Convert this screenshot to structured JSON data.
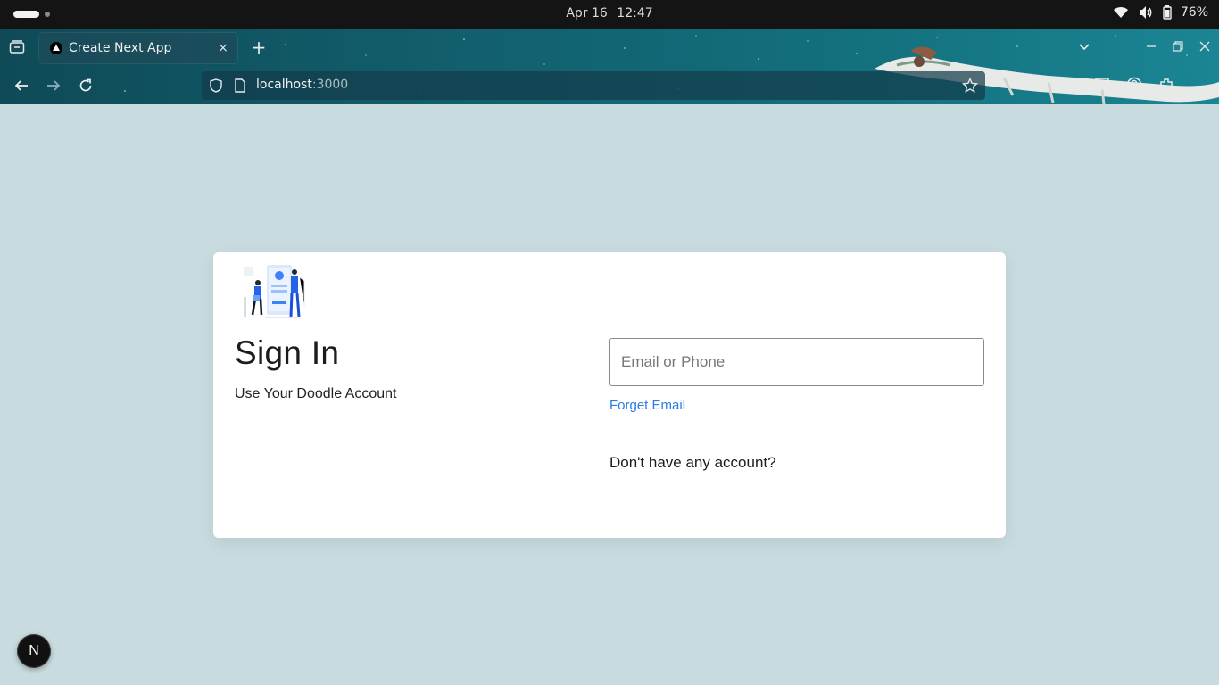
{
  "os": {
    "date": "Apr 16",
    "time": "12:47",
    "battery": "76%"
  },
  "browser": {
    "tab_title": "Create Next App",
    "tab_close": "×",
    "new_tab": "+",
    "url_host": "localhost",
    "url_port": ":3000"
  },
  "page": {
    "title": "Sign In",
    "subtitle": "Use Your Doodle Account",
    "email_placeholder": "Email or Phone",
    "email_value": "",
    "forget_link": "Forget Email",
    "no_account": "Don't have any account?",
    "next_badge": "N"
  },
  "colors": {
    "page_bg": "#c8dbdf",
    "card_bg": "#ffffff",
    "link": "#2c7be5",
    "browser_bg": "#12606e"
  },
  "icons": [
    "tab-overview-icon",
    "close-icon",
    "plus-icon",
    "chevron-down-icon",
    "minimize-icon",
    "restore-icon",
    "back-icon",
    "forward-icon",
    "reload-icon",
    "shield-icon",
    "page-icon",
    "star-icon",
    "pocket-icon",
    "account-icon",
    "extensions-icon",
    "wifi-icon",
    "volume-icon",
    "battery-icon"
  ]
}
